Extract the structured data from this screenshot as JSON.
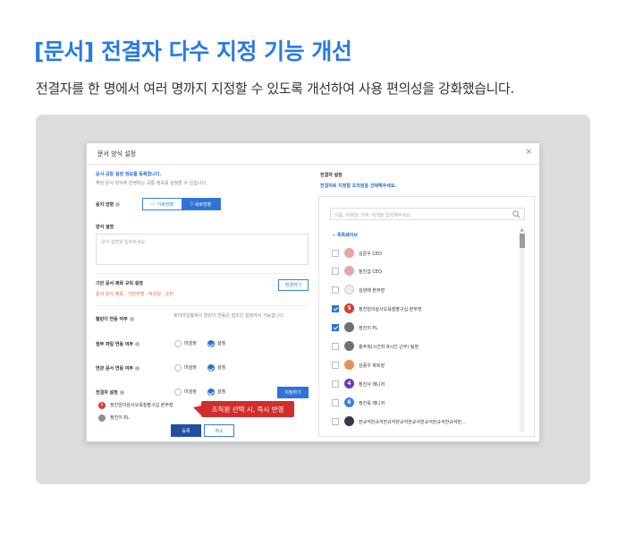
{
  "header": {
    "title": "[문서] 전결자 다수 지정 기능 개선",
    "subtitle": "전결자를 한 명에서 여러 명까지 지정할 수 있도록 개선하여 사용 편의성을 강화했습니다."
  },
  "dialog": {
    "title": "문서 양식 설정",
    "close": "×",
    "intro_title": "문서 공통 설정 정보를 등록합니다.",
    "intro_desc": "해당 문서 양식에 반영되는 공통 정보를 설정할 수 있습니다.",
    "orientation": {
      "label": "용지 방향",
      "options": [
        "가로방향",
        "세로방향"
      ],
      "selected": "세로방향"
    },
    "description": {
      "label": "양식 설명",
      "placeholder": "양식 설명을 입력하세요."
    },
    "title_rule": {
      "label": "기안 문서 제목 규칙 설정",
      "value": "문서 양식 제목 - 기안자명 - 작성일 - 순번",
      "button": "변경하기"
    },
    "calendar_link": {
      "label": "캘린더 연동 여부",
      "desc": "휴리마일홈에서 힐린더 연동은 협조인 설정에서 가능합니다."
    },
    "attach_link": {
      "label": "첨부 파일 연동 여부",
      "options": [
        "미설정",
        "설정"
      ],
      "selected": "설정"
    },
    "related_link": {
      "label": "연관 문서 연동 여부",
      "options": [
        "미설정",
        "설정"
      ],
      "selected": "설정"
    },
    "approver": {
      "label": "전결자 설정",
      "options": [
        "미설정",
        "설정"
      ],
      "selected": "설정",
      "button": "지정하기",
      "selected_people": [
        "정진임이삼사오육칠팔구십 본부장",
        "정진이 PL"
      ]
    },
    "callout": "조직원 선택 시, 즉시 반영",
    "footer": {
      "confirm": "등록",
      "cancel": "취소"
    },
    "right": {
      "title": "전결자 설정",
      "desc": "전결자로 지정할 조직원을 선택해주세요.",
      "search_placeholder": "이름, 이메일, 직위, 직책을 입력해주세요.",
      "org_name": "톡톡웨이브",
      "members": [
        {
          "name": "김준우 CEO",
          "checked": false,
          "avatar": "pink"
        },
        {
          "name": "정진섭 CEO",
          "checked": false,
          "avatar": "pink"
        },
        {
          "name": "김양배 본부장",
          "checked": false,
          "avatar": "stamp"
        },
        {
          "name": "정진임이삼사오육칠팔구십 본부장",
          "checked": true,
          "avatar": "red",
          "num": "5"
        },
        {
          "name": "정진이 PL",
          "checked": true,
          "avatar": "photo"
        },
        {
          "name": "홍주희(시간차 8시간 근무) 팀장",
          "checked": false,
          "avatar": "photo"
        },
        {
          "name": "성풍우 파트장",
          "checked": false,
          "avatar": "orange"
        },
        {
          "name": "정진사 매니저",
          "checked": false,
          "avatar": "purple",
          "num": "4"
        },
        {
          "name": "정진육 매니저",
          "checked": false,
          "avatar": "blue",
          "num": "6"
        },
        {
          "name": "한규석한규석한규석한규석한규석한규석한규석한규석한...",
          "checked": false,
          "avatar": "dark"
        }
      ]
    }
  }
}
